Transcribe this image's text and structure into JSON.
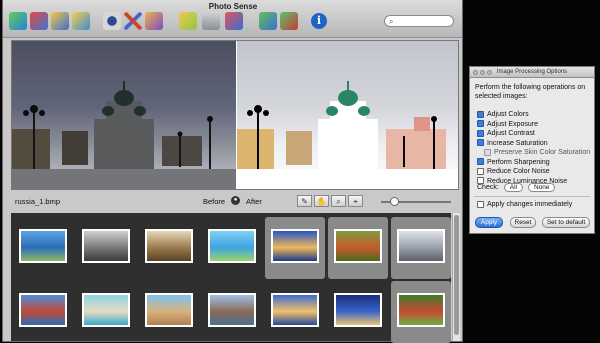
{
  "window": {
    "title": "Photo Sense"
  },
  "toolbar": {
    "icons": [
      "add-images-icon",
      "batch-icon",
      "open-folder-icon",
      "open-photos-icon",
      "preview-icon",
      "tools-icon",
      "process-icon",
      "filters-icon",
      "adjustments-icon",
      "export-icon",
      "info-icon"
    ],
    "info_glyph": "i"
  },
  "search": {
    "glyph": "⌕",
    "placeholder": ""
  },
  "preview": {
    "filename": "russia_1.bmp",
    "before_label": "Before",
    "after_label": "After"
  },
  "thumbnails": {
    "row1": [
      {
        "name": "windmill-blue",
        "colors": [
          "#5aa3e4",
          "#2b6db8",
          "#8fb86a"
        ],
        "selected": false
      },
      {
        "name": "windmill-bw",
        "colors": [
          "#cfcfcf",
          "#7a7a7a",
          "#3a3a3a"
        ],
        "selected": false
      },
      {
        "name": "windmill-sepia",
        "colors": [
          "#e8d7b7",
          "#9a7c4f",
          "#5a4226"
        ],
        "selected": false
      },
      {
        "name": "windmill-bright",
        "colors": [
          "#7fd0f5",
          "#3fa3e0",
          "#9bd46a"
        ],
        "selected": false
      },
      {
        "name": "castle-night",
        "colors": [
          "#2856c7",
          "#f0b85a",
          "#1b3b8a"
        ],
        "selected": true
      },
      {
        "name": "portrait-field",
        "colors": [
          "#7e9b42",
          "#c65a2c",
          "#4b6a1f"
        ],
        "selected": true
      },
      {
        "name": "russia-church",
        "colors": [
          "#dfe2e8",
          "#9aa0aa",
          "#5d5f66"
        ],
        "selected": true
      }
    ],
    "row2": [
      {
        "name": "coast-house",
        "colors": [
          "#4b8fd8",
          "#c24a3a",
          "#2e6bb0"
        ],
        "selected": false
      },
      {
        "name": "beach-cliffs",
        "colors": [
          "#8dd2e6",
          "#e8dcc2",
          "#3aa9c8"
        ],
        "selected": false
      },
      {
        "name": "sand-dunes",
        "colors": [
          "#7ec3ef",
          "#d9b27c",
          "#b08050"
        ],
        "selected": false
      },
      {
        "name": "town-river",
        "colors": [
          "#9ec1e8",
          "#8a6a5a",
          "#4f6e8c"
        ],
        "selected": false
      },
      {
        "name": "lake-sunset",
        "colors": [
          "#3e6ccc",
          "#f2c16a",
          "#25489a"
        ],
        "selected": false
      },
      {
        "name": "city-night",
        "colors": [
          "#1a2e7a",
          "#3a62c9",
          "#e8c873"
        ],
        "selected": false
      },
      {
        "name": "portrait-grass",
        "colors": [
          "#3e7d2a",
          "#c64a34",
          "#6fae43"
        ],
        "selected": true
      }
    ]
  },
  "options_panel": {
    "title": "Image Processing Options",
    "intro": "Perform the following operations on selected images:",
    "items": [
      {
        "label": "Adjust Colors",
        "checked": true,
        "sub": false
      },
      {
        "label": "Adjust Exposure",
        "checked": true,
        "sub": false
      },
      {
        "label": "Adjust Contrast",
        "checked": true,
        "sub": false
      },
      {
        "label": "Increase Saturation",
        "checked": true,
        "sub": false
      },
      {
        "label": "Preserve Skin Color Saturation",
        "checked": false,
        "sub": true
      },
      {
        "label": "Perform Sharpening",
        "checked": true,
        "sub": false
      },
      {
        "label": "Reduce Color Noise",
        "checked": false,
        "sub": false
      },
      {
        "label": "Reduce Luminance Noise",
        "checked": false,
        "sub": false
      }
    ],
    "check_label": "Check:",
    "check_all": "All",
    "check_none": "None",
    "apply_immediately": "Apply changes immediately",
    "apply_button": "Apply",
    "reset_button": "Reset",
    "default_button": "Set to default"
  },
  "colors": {
    "accent": "#2b6fd6",
    "info": "#1f63c6"
  }
}
